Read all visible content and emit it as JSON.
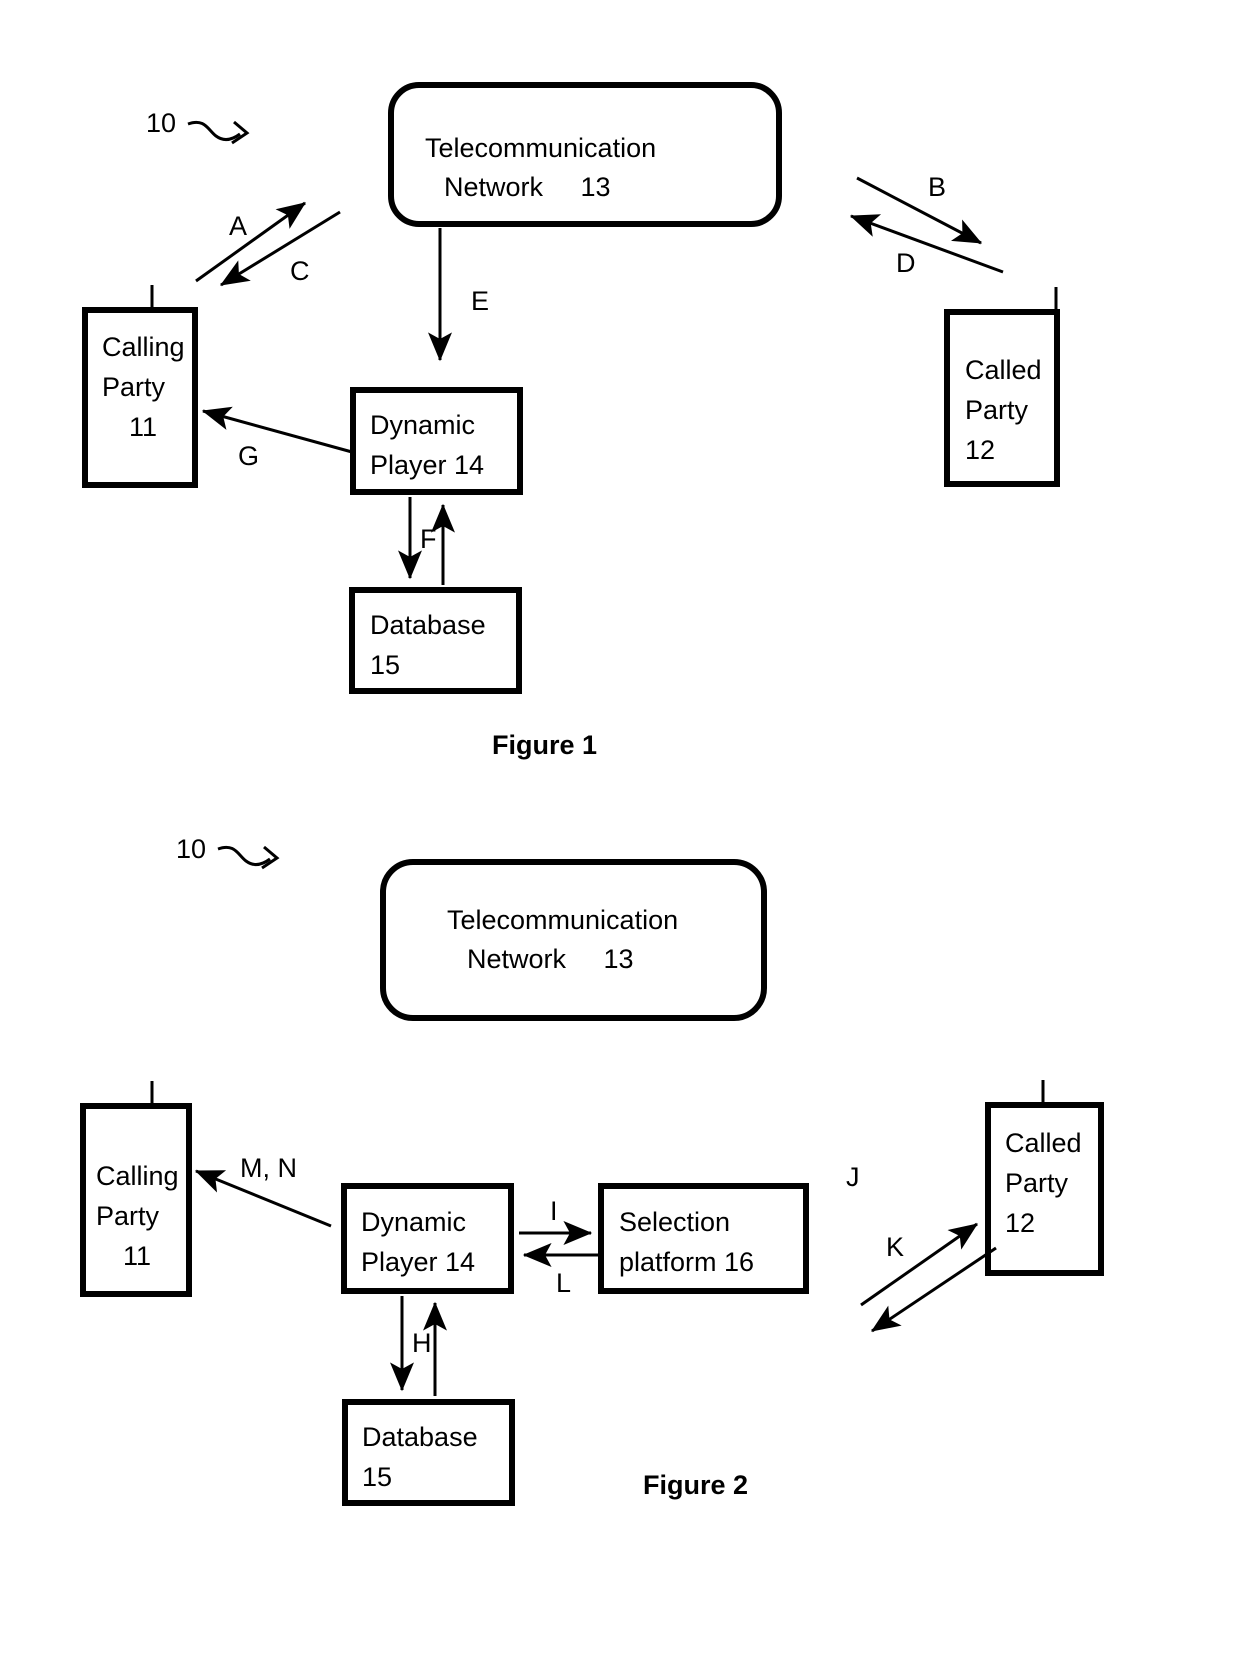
{
  "document": {
    "type": "patent-figure-sheet",
    "background_color": "#ffffff",
    "line_color": "#000000"
  },
  "figures": [
    {
      "id": "figure-1",
      "caption": "Figure 1",
      "reference_numeral": "10",
      "nodes": [
        {
          "id": "telecom-network-1",
          "shape": "rounded-rect",
          "line1": "Telecommunication",
          "line2": "Network     13",
          "label": "Telecommunication Network 13"
        },
        {
          "id": "calling-party-1",
          "shape": "phone",
          "line1": "Calling",
          "line2": "Party",
          "line3": "11",
          "label": "Calling Party 11"
        },
        {
          "id": "called-party-1",
          "shape": "phone",
          "line1": "Called",
          "line2": "Party",
          "line3": "12",
          "label": "Called Party 12"
        },
        {
          "id": "dynamic-player-1",
          "shape": "rect",
          "line1": "Dynamic",
          "line2": "Player 14",
          "label": "Dynamic Player 14"
        },
        {
          "id": "database-1",
          "shape": "rect",
          "line1": "Database",
          "line2": "15",
          "label": "Database 15"
        }
      ],
      "edges": [
        {
          "label": "A",
          "from": "calling-party-1",
          "to": "telecom-network-1",
          "direction": "up-right"
        },
        {
          "label": "C",
          "from": "telecom-network-1",
          "to": "calling-party-1",
          "direction": "down-left"
        },
        {
          "label": "B",
          "from": "telecom-network-1",
          "to": "called-party-1",
          "direction": "down-right"
        },
        {
          "label": "D",
          "from": "called-party-1",
          "to": "telecom-network-1",
          "direction": "up-left"
        },
        {
          "label": "E",
          "from": "telecom-network-1",
          "to": "dynamic-player-1",
          "direction": "down"
        },
        {
          "label": "F",
          "from": "dynamic-player-1",
          "to": "database-1",
          "direction": "bidirectional-vertical"
        },
        {
          "label": "G",
          "from": "dynamic-player-1",
          "to": "calling-party-1",
          "direction": "up-left"
        }
      ]
    },
    {
      "id": "figure-2",
      "caption": "Figure 2",
      "reference_numeral": "10",
      "nodes": [
        {
          "id": "telecom-network-2",
          "shape": "rounded-rect",
          "line1": "Telecommunication",
          "line2": "Network     13",
          "label": "Telecommunication Network 13"
        },
        {
          "id": "calling-party-2",
          "shape": "phone",
          "line1": "Calling",
          "line2": "Party",
          "line3": "11",
          "label": "Calling Party 11"
        },
        {
          "id": "called-party-2",
          "shape": "phone",
          "line1": "Called",
          "line2": "Party",
          "line3": "12",
          "label": "Called Party 12"
        },
        {
          "id": "dynamic-player-2",
          "shape": "rect",
          "line1": "Dynamic",
          "line2": "Player 14",
          "label": "Dynamic Player 14"
        },
        {
          "id": "selection-platform-2",
          "shape": "rect",
          "line1": "Selection",
          "line2": "platform 16",
          "label": "Selection platform 16"
        },
        {
          "id": "database-2",
          "shape": "rect",
          "line1": "Database",
          "line2": "15",
          "label": "Database 15"
        }
      ],
      "edges": [
        {
          "label": "M, N",
          "from": "dynamic-player-2",
          "to": "calling-party-2",
          "direction": "up-left"
        },
        {
          "label": "I",
          "from": "dynamic-player-2",
          "to": "selection-platform-2",
          "direction": "right"
        },
        {
          "label": "L",
          "from": "selection-platform-2",
          "to": "dynamic-player-2",
          "direction": "left"
        },
        {
          "label": "J",
          "from": "selection-platform-2",
          "to": "called-party-2",
          "direction": "up-right"
        },
        {
          "label": "K",
          "from": "called-party-2",
          "to": "selection-platform-2",
          "direction": "down-left"
        },
        {
          "label": "H",
          "from": "dynamic-player-2",
          "to": "database-2",
          "direction": "bidirectional-vertical"
        }
      ]
    }
  ]
}
